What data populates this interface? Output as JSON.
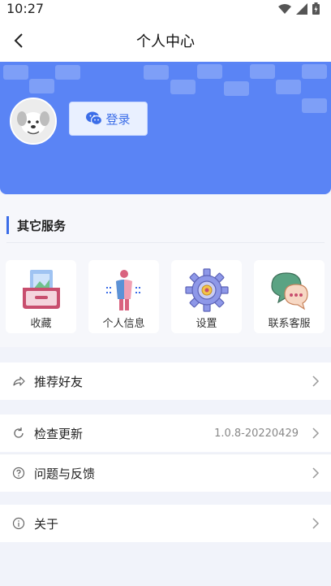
{
  "status_bar": {
    "time": "10:27",
    "icons": [
      "wifi-icon",
      "signal-icon",
      "battery-icon"
    ]
  },
  "nav": {
    "title": "个人中心",
    "back_icon": "chevron-left-icon"
  },
  "profile": {
    "login_label": "登录",
    "login_icon": "wechat-icon",
    "banner_color": "#5a84f5"
  },
  "services": {
    "section_title": "其它服务",
    "accent": "#3b6de8",
    "items": [
      {
        "label": "收藏",
        "icon": "favorites-box-icon"
      },
      {
        "label": "个人信息",
        "icon": "person-info-icon"
      },
      {
        "label": "设置",
        "icon": "settings-gear-icon"
      },
      {
        "label": "联系客服",
        "icon": "chat-bubbles-icon"
      }
    ]
  },
  "menu": {
    "recommend": {
      "label": "推荐好友",
      "icon": "share-icon"
    },
    "update": {
      "label": "检查更新",
      "icon": "refresh-icon",
      "value": "1.0.8-20220429"
    },
    "feedback": {
      "label": "问题与反馈",
      "icon": "question-icon"
    },
    "about": {
      "label": "关于",
      "icon": "info-icon"
    }
  }
}
